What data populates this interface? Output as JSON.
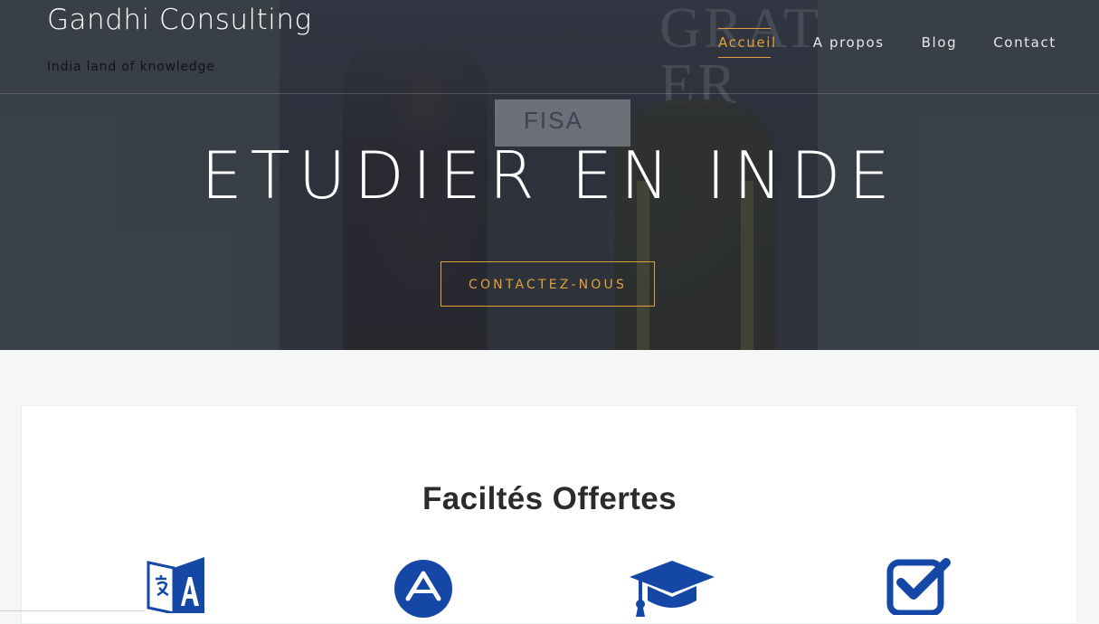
{
  "header": {
    "site_title": "Gandhi Consulting",
    "tagline": "India land of knowledge"
  },
  "nav": {
    "items": [
      {
        "label": "Accueil",
        "active": true
      },
      {
        "label": "A propos",
        "active": false
      },
      {
        "label": "Blog",
        "active": false
      },
      {
        "label": "Contact",
        "active": false
      }
    ]
  },
  "hero": {
    "heading": "ETUDIER EN INDE",
    "cta_label": "CONTACTEZ-NOUS",
    "photo_banner_text": "FISA",
    "photo_background_text": "GRAT\nER"
  },
  "facilities": {
    "title": "Faciltés Offertes",
    "icons": [
      "translation-icon",
      "app-store-icon",
      "graduation-cap-icon",
      "checkbox-icon"
    ]
  },
  "colors": {
    "accent": "#e0a13a",
    "icon_blue": "#1548a6",
    "hero_overlay": "#3a4048",
    "page_bg": "#f4f7f6"
  }
}
